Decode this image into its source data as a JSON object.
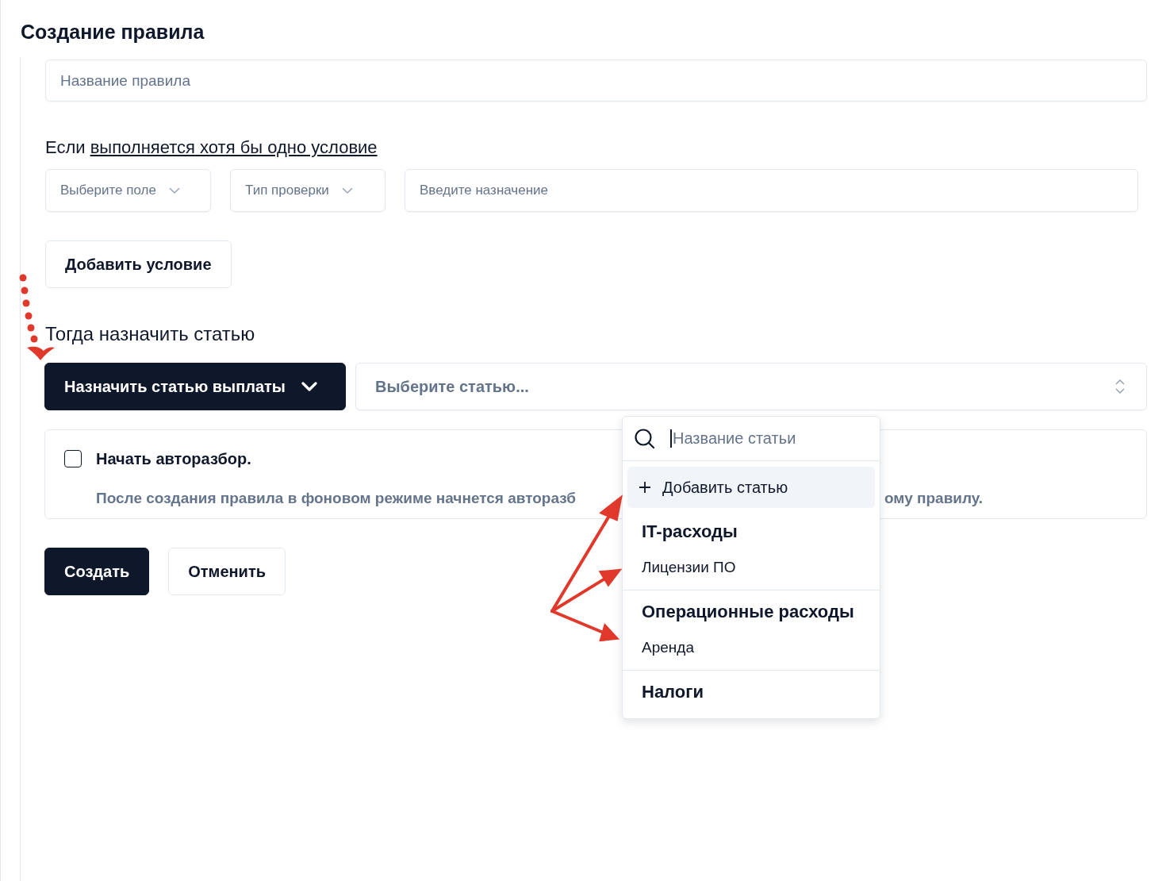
{
  "title": "Создание правила",
  "rule_name": {
    "placeholder": "Название правила"
  },
  "condition": {
    "prefix": "Если",
    "mode_link": "выполняется хотя бы одно условие"
  },
  "condition_row": {
    "field_select": {
      "placeholder": "Выберите поле"
    },
    "check_select": {
      "placeholder": "Тип проверки"
    },
    "value_input": {
      "placeholder": "Введите назначение"
    }
  },
  "add_condition_button": "Добавить условие",
  "action": {
    "heading": "Тогда назначить статью",
    "action_button": "Назначить статью выплаты",
    "article_select": {
      "placeholder": "Выберите статью..."
    }
  },
  "autoparse": {
    "checked": false,
    "label": "Начать авторазбор.",
    "description_start": "После создания правила в фоновом режиме начнется авторазб",
    "description_end": "ому правилу."
  },
  "buttons": [
    {
      "label": "Создать",
      "kind": "primary"
    },
    {
      "label": "Отменить",
      "kind": "secondary"
    }
  ],
  "dropdown": {
    "search": {
      "placeholder": "Название статьи"
    },
    "add_item": {
      "label": "Добавить статью",
      "selected": true
    },
    "groups": [
      {
        "name": "IT-расходы",
        "items": [
          {
            "label": "Лицензии ПО",
            "selected": false
          }
        ]
      },
      {
        "name": "Операционные расходы",
        "items": [
          {
            "label": "Аренда",
            "selected": false
          }
        ]
      },
      {
        "name": "Налоги"
      }
    ]
  }
}
